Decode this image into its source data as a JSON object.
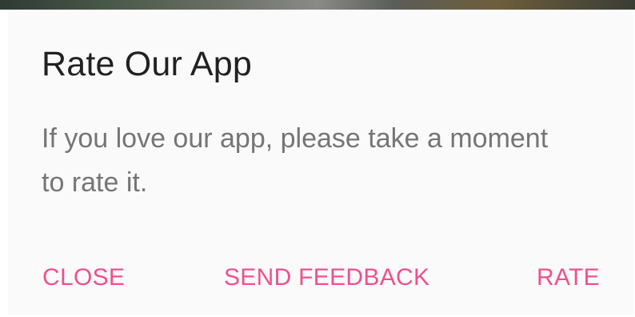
{
  "dialog": {
    "title": "Rate Our App",
    "message": "If you love our app, please take a moment to rate it.",
    "buttons": {
      "close": "CLOSE",
      "send_feedback": "SEND FEEDBACK",
      "rate": "RATE"
    }
  },
  "colors": {
    "accent": "#f0508c",
    "title_text": "#212121",
    "message_text": "#757575",
    "dialog_background": "#fafafa"
  }
}
